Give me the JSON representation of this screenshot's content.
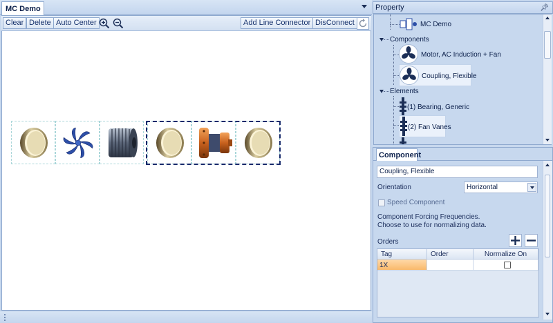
{
  "document": {
    "tab_label": "MC Demo"
  },
  "toolbar": {
    "clear_label": "Clear",
    "delete_label": "Delete",
    "auto_center_label": "Auto Center",
    "add_line_connector_label": "Add Line Connector",
    "disconnect_label": "DisConnect",
    "zoom_in_icon": "zoom-in-icon",
    "zoom_out_icon": "zoom-out-icon",
    "refresh_icon": "refresh-icon"
  },
  "canvas": {
    "components": [
      {
        "icon": "bearing-icon"
      },
      {
        "icon": "fan-icon"
      },
      {
        "icon": "motor-housing-icon"
      },
      {
        "icon": "bearing-icon"
      },
      {
        "icon": "flexible-coupling-icon"
      },
      {
        "icon": "bearing-icon"
      }
    ],
    "selection_color": "#16296b"
  },
  "property_panel": {
    "header_label": "Property",
    "pin_icon": "pin-icon",
    "tree": {
      "root": {
        "label": "MC Demo",
        "icon": "machine-train-icon"
      },
      "components_label": "Components",
      "components": [
        {
          "label": "Motor, AC Induction + Fan",
          "icon": "motor-fan-icon"
        },
        {
          "label": "Coupling, Flexible",
          "icon": "coupling-icon",
          "selected": true
        }
      ],
      "elements_label": "Elements",
      "elements": [
        {
          "label": "(1) Bearing, Generic",
          "icon": "bearing-element-icon"
        },
        {
          "label": "(2) Fan Vanes",
          "icon": "fan-vanes-icon",
          "selected": true
        }
      ]
    }
  },
  "component_panel": {
    "tab_label": "Component",
    "name_value": "Coupling, Flexible",
    "orientation_label": "Orientation",
    "orientation_value": "Horizontal",
    "speed_component_label": "Speed Component",
    "forcing_text_line1": "Component Forcing Frequencies.",
    "forcing_text_line2": "Choose to use for normalizing data.",
    "orders_label": "Orders",
    "add_icon": "plus-icon",
    "remove_icon": "minus-icon",
    "orders_columns": [
      "Tag",
      "Order",
      "Normalize On"
    ],
    "orders_rows": [
      {
        "tag": "1X",
        "order": "",
        "normalize_on": false
      }
    ]
  },
  "colors": {
    "panel_bg": "#c7d8ee",
    "accent_border": "#8fa9cf",
    "selected_cell": "#f9b96b"
  }
}
